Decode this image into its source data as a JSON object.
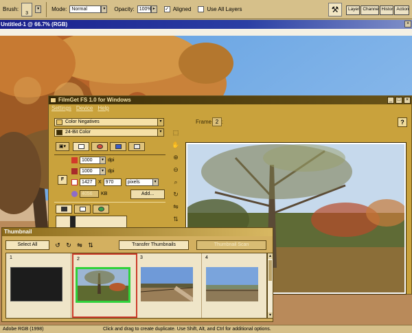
{
  "options_bar": {
    "brush_label": "Brush:",
    "brush_size": "3",
    "mode_label": "Mode:",
    "mode_value": "Normal",
    "opacity_label": "Opacity:",
    "opacity_value": "100%",
    "aligned_label": "Aligned",
    "aligned_checked": true,
    "use_all_layers_label": "Use All Layers",
    "use_all_layers_checked": false,
    "palette_tabs": [
      "Layers",
      "Channels",
      "History",
      "Actions"
    ]
  },
  "document": {
    "title": "Untitled-1 @ 66.7% (RGB)"
  },
  "filmget": {
    "title": "FilmGet FS 1.0 for Windows",
    "menu": [
      "Settings",
      "Device",
      "Help"
    ],
    "film_type": "Color Negatives",
    "color_mode": "24-Bit Color",
    "input_dpi": "1000",
    "output_dpi": "1000",
    "dpi_unit": "dpi",
    "width": "1427",
    "height": "970",
    "units": "pixels",
    "size_value": "4056",
    "size_unit": "KB",
    "add_label": "Add...",
    "frame_label": "Frame No.:",
    "frame_value": "2",
    "help_icon": "?",
    "dimension_sep": "X",
    "tool_labels": [
      "F"
    ]
  },
  "thumbnail": {
    "title": "Thumbnail",
    "select_all": "Select All",
    "transfer": "Transfer Thumbnails",
    "scan": "Thumbnail Scan",
    "frames": [
      "1",
      "2",
      "3",
      "4"
    ],
    "selected_frame": "2"
  },
  "status": {
    "profile": "Adobe RGB (1998)",
    "hint": "Click and drag to create duplicate. Use Shift, Alt, and Ctrl for additional options."
  },
  "icons": {
    "wrench": "wrench-icon",
    "help": "help-icon",
    "zoom": "zoom-in-icon",
    "hand": "hand-icon"
  }
}
